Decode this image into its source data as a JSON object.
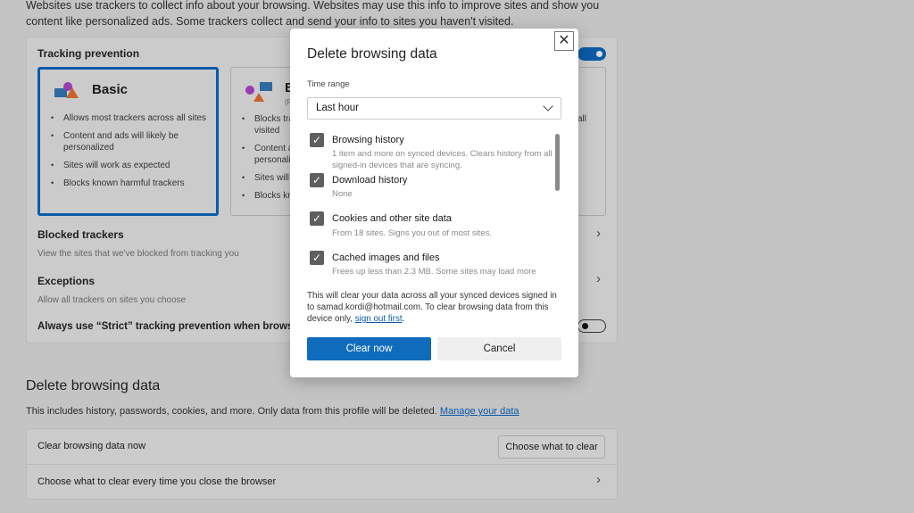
{
  "intro": "Websites use trackers to collect info about your browsing. Websites may use this info to improve sites and show you content like personalized ads. Some trackers collect and send your info to sites you haven't visited.",
  "tracking": {
    "title": "Tracking prevention",
    "basic": {
      "label": "Basic",
      "bullets": [
        "Allows most trackers across all sites",
        "Content and ads will likely be personalized",
        "Sites will work as expected",
        "Blocks known harmful trackers"
      ]
    },
    "balanced": {
      "label": "B",
      "note": "(R",
      "bullets": [
        "Blocks tra",
        "visited",
        "Content a",
        "personali",
        "Sites will",
        "Blocks kn"
      ]
    },
    "strict_fragment": "all",
    "blocked_title": "Blocked trackers",
    "blocked_desc": "View the sites that we've blocked from tracking you",
    "exceptions_title": "Exceptions",
    "exceptions_desc": "Allow all trackers on sites you choose",
    "strict_inprivate": "Always use “Strict” tracking prevention when browsing",
    "toggle_on": true,
    "strict_toggle_on": false
  },
  "delete": {
    "title": "Delete browsing data",
    "desc": "This includes history, passwords, cookies, and more. Only data from this profile will be deleted.",
    "manage_link": "Manage your data",
    "clear_now_label": "Clear browsing data now",
    "choose_button": "Choose what to clear",
    "on_close_label": "Choose what to clear every time you close the browser"
  },
  "dialog": {
    "title": "Delete browsing data",
    "time_range_label": "Time range",
    "time_range_value": "Last hour",
    "items": [
      {
        "label": "Browsing history",
        "desc": "1 item and more on synced devices. Clears history from all signed-in devices that are syncing.",
        "checked": true
      },
      {
        "label": "Download history",
        "desc": "None",
        "checked": true
      },
      {
        "label": "Cookies and other site data",
        "desc": "From 18 sites. Signs you out of most sites.",
        "checked": true
      },
      {
        "label": "Cached images and files",
        "desc": "Frees up less than 2.3 MB. Some sites may load more",
        "checked": true
      }
    ],
    "notice": "This will clear your data across all your synced devices signed in to samad.kordi@hotmail.com. To clear browsing data from this device only,",
    "sign_out_link": "sign out first",
    "clear_button": "Clear now",
    "cancel_button": "Cancel"
  },
  "colors": {
    "accent": "#0f6cbd",
    "overlay": "#c4c4c4"
  }
}
